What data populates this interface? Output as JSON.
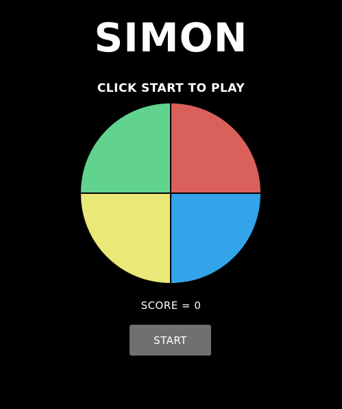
{
  "header": {
    "title": "SIMON",
    "status": "CLICK START TO PLAY"
  },
  "board": {
    "pads": [
      {
        "name": "green",
        "color": "#62d38f"
      },
      {
        "name": "red",
        "color": "#da615b"
      },
      {
        "name": "yellow",
        "color": "#eae977"
      },
      {
        "name": "blue",
        "color": "#33a3ea"
      }
    ]
  },
  "score": {
    "text": "SCORE = 0"
  },
  "controls": {
    "start_label": "START",
    "button_color": "#707070"
  }
}
